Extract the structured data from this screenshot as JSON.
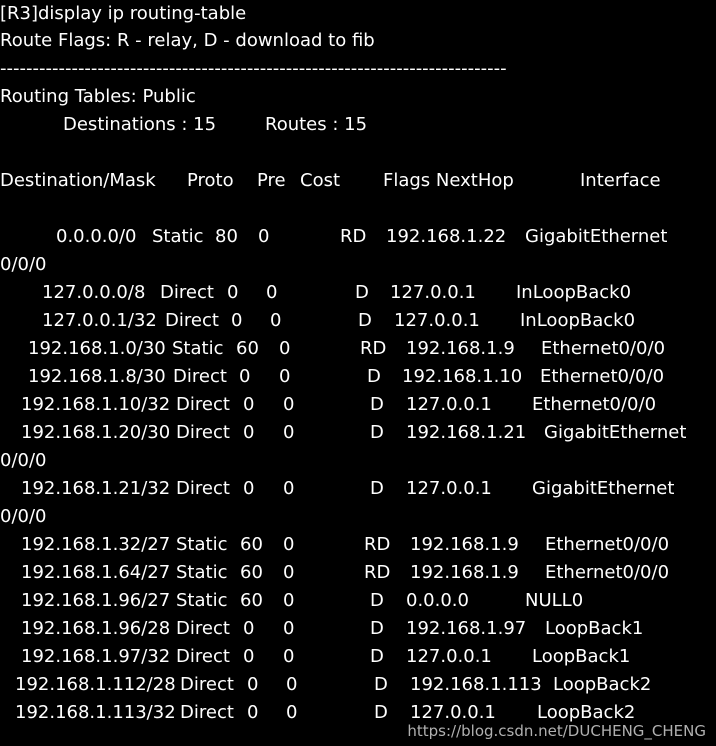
{
  "command": "[R3]display ip routing-table",
  "flags_legend": "Route Flags: R - relay, D - download to fib",
  "separator": "------------------------------------------------------------------------------",
  "table_title": "Routing Tables: Public",
  "summary": {
    "destinations": "Destinations : 15",
    "routes": "Routes : 15"
  },
  "headers": {
    "dest": "Destination/Mask",
    "proto": "Proto",
    "pre": "Pre",
    "cost": "Cost",
    "flags_nexthop": "Flags NextHop",
    "iface": "Interface"
  },
  "rows": [
    {
      "dest": "0.0.0.0/0",
      "proto": "Static",
      "pre": "80",
      "cost": "0",
      "flags": "RD",
      "nexthop": "192.168.1.22",
      "iface": "GigabitEthernet",
      "wrap": "0/0/0"
    },
    {
      "dest": "127.0.0.0/8",
      "proto": "Direct",
      "pre": "0",
      "cost": "0",
      "flags": "D",
      "nexthop": "127.0.0.1",
      "iface": "InLoopBack0"
    },
    {
      "dest": "127.0.0.1/32",
      "proto": "Direct",
      "pre": "0",
      "cost": "0",
      "flags": "D",
      "nexthop": "127.0.0.1",
      "iface": "InLoopBack0"
    },
    {
      "dest": "192.168.1.0/30",
      "proto": "Static",
      "pre": "60",
      "cost": "0",
      "flags": "RD",
      "nexthop": "192.168.1.9",
      "iface": "Ethernet0/0/0"
    },
    {
      "dest": "192.168.1.8/30",
      "proto": "Direct",
      "pre": "0",
      "cost": "0",
      "flags": "D",
      "nexthop": "192.168.1.10",
      "iface": "Ethernet0/0/0"
    },
    {
      "dest": "192.168.1.10/32",
      "proto": "Direct",
      "pre": "0",
      "cost": "0",
      "flags": "D",
      "nexthop": "127.0.0.1",
      "iface": "Ethernet0/0/0"
    },
    {
      "dest": "192.168.1.20/30",
      "proto": "Direct",
      "pre": "0",
      "cost": "0",
      "flags": "D",
      "nexthop": "192.168.1.21",
      "iface": "GigabitEthernet",
      "wrap": "0/0/0"
    },
    {
      "dest": "192.168.1.21/32",
      "proto": "Direct",
      "pre": "0",
      "cost": "0",
      "flags": "D",
      "nexthop": "127.0.0.1",
      "iface": "GigabitEthernet",
      "wrap": "0/0/0"
    },
    {
      "dest": "192.168.1.32/27",
      "proto": "Static",
      "pre": "60",
      "cost": "0",
      "flags": "RD",
      "nexthop": "192.168.1.9",
      "iface": "Ethernet0/0/0"
    },
    {
      "dest": "192.168.1.64/27",
      "proto": "Static",
      "pre": "60",
      "cost": "0",
      "flags": "RD",
      "nexthop": "192.168.1.9",
      "iface": "Ethernet0/0/0"
    },
    {
      "dest": "192.168.1.96/27",
      "proto": "Static",
      "pre": "60",
      "cost": "0",
      "flags": "D",
      "nexthop": "0.0.0.0",
      "iface": "NULL0"
    },
    {
      "dest": "192.168.1.96/28",
      "proto": "Direct",
      "pre": "0",
      "cost": "0",
      "flags": "D",
      "nexthop": "192.168.1.97",
      "iface": "LoopBack1"
    },
    {
      "dest": "192.168.1.97/32",
      "proto": "Direct",
      "pre": "0",
      "cost": "0",
      "flags": "D",
      "nexthop": "127.0.0.1",
      "iface": "LoopBack1"
    },
    {
      "dest": "192.168.1.112/28",
      "proto": "Direct",
      "pre": "0",
      "cost": "0",
      "flags": "D",
      "nexthop": "192.168.1.113",
      "iface": "LoopBack2"
    },
    {
      "dest": "192.168.1.113/32",
      "proto": "Direct",
      "pre": "0",
      "cost": "0",
      "flags": "D",
      "nexthop": "127.0.0.1",
      "iface": "LoopBack2"
    }
  ],
  "watermark": "https://blog.csdn.net/DUCHENG_CHENG",
  "colors": {
    "background": "#000000",
    "text": "#ffffff"
  }
}
